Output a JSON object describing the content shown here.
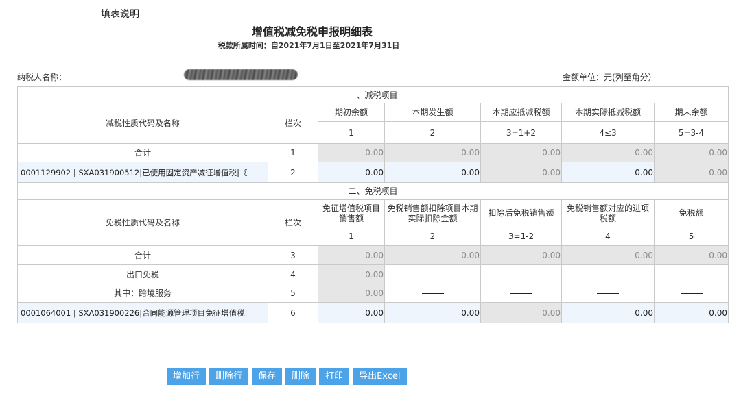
{
  "header": {
    "instructions_link": "填表说明",
    "title": "增值税减免税申报明细表",
    "period": "税款所属时间：自2021年7月1日至2021年7月31日",
    "payer_label": "纳税人名称：",
    "unit_label": "金额单位：元(列至角分）"
  },
  "reduction": {
    "section_title": "一、减税项目",
    "name_header": "减税性质代码及名称",
    "row_no_header": "栏次",
    "columns": [
      "期初余额",
      "本期发生额",
      "本期应抵减税额",
      "本期实际抵减税额",
      "期末余额"
    ],
    "column_numbers": [
      "1",
      "2",
      "3=1+2",
      "4≤3",
      "5=3-4"
    ],
    "total_row": {
      "label": "合计",
      "no": "1",
      "values": [
        "0.00",
        "0.00",
        "0.00",
        "0.00",
        "0.00"
      ]
    },
    "item_row": {
      "label": "0001129902 | SXA031900512|已使用固定资产减征增值税|《",
      "no": "2",
      "values": [
        "0.00",
        "0.00",
        "0.00",
        "0.00",
        "0.00"
      ]
    }
  },
  "exemption": {
    "section_title": "二、免税项目",
    "name_header": "免税性质代码及名称",
    "row_no_header": "栏次",
    "columns": [
      "免征增值税项目销售额",
      "免税销售额扣除项目本期实际扣除金额",
      "扣除后免税销售额",
      "免税销售额对应的进项税额",
      "免税额"
    ],
    "column_numbers": [
      "1",
      "2",
      "3=1-2",
      "4",
      "5"
    ],
    "total_row": {
      "label": "合计",
      "no": "3",
      "values": [
        "0.00",
        "0.00",
        "0.00",
        "0.00",
        "0.00"
      ]
    },
    "export_row": {
      "label": "出口免税",
      "no": "4",
      "value": "0.00"
    },
    "crossborder_row": {
      "label": "其中：跨境服务",
      "no": "5",
      "value": "0.00"
    },
    "item_row": {
      "label": "0001064001 | SXA031900226|合同能源管理项目免征增值税|",
      "no": "6",
      "values": [
        "0.00",
        "0.00",
        "0.00",
        "0.00",
        "0.00"
      ]
    }
  },
  "buttons": {
    "add_row": "增加行",
    "delete_row": "删除行",
    "save": "保存",
    "delete": "删除",
    "print": "打印",
    "export": "导出Excel"
  }
}
